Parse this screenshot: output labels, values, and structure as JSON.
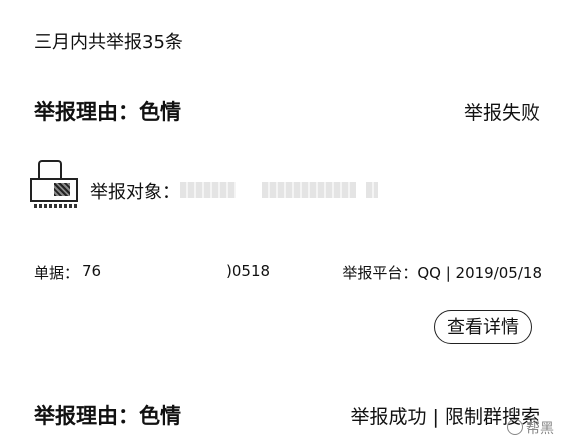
{
  "summary": {
    "text": "三月内共举报35条"
  },
  "reports": [
    {
      "reason": "举报理由：色情",
      "status": "举报失败",
      "target_label": "举报对象：",
      "doc_label": "单据：",
      "doc_prefix": "76",
      "doc_suffix": ")0518",
      "platform_info": "举报平台：QQ | 2019/05/18",
      "details_label": "查看详情"
    },
    {
      "reason": "举报理由：色情",
      "status": "举报成功 | 限制群搜索"
    }
  ],
  "watermark": {
    "text": "帮黑"
  }
}
